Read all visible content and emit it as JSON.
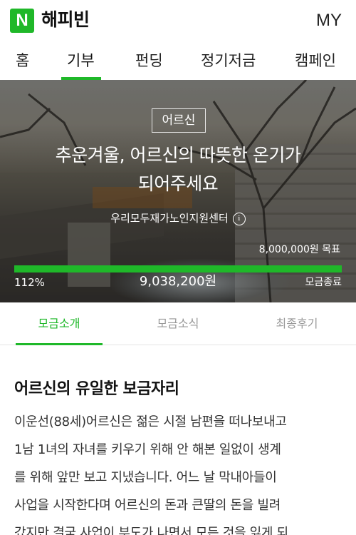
{
  "header": {
    "logo_letter": "N",
    "brand": "해피빈",
    "my_label": "MY"
  },
  "gnb": {
    "items": [
      "홈",
      "기부",
      "펀딩",
      "정기저금",
      "캠페인"
    ],
    "active_index": 1
  },
  "campaign": {
    "category": "어르신",
    "title_line1": "추운겨울, 어르신의 따뜻한 온기가",
    "title_line2": "되어주세요",
    "organization": "우리모두재가노인지원센터",
    "info_icon": "info-icon",
    "goal_text": "8,000,000원 목표",
    "progress_fraction": 1.0,
    "percent_text": "112%",
    "raised_text": "9,038,200원",
    "status_text": "모금종료"
  },
  "tabs": {
    "items": [
      "모금소개",
      "모금소식",
      "최종후기"
    ],
    "active_index": 0
  },
  "story": {
    "heading": "어르신의 유일한 보금자리",
    "lines": [
      "이운선(88세)어르신은 젊은 시절 남편을 떠나보내고",
      "1남 1녀의 자녀를 키우기 위해 안 해본 일없이 생계",
      "를 위해 앞만 보고 지냈습니다. 어느 날 막내아들이",
      "사업을 시작한다며 어르신의 돈과 큰딸의 돈을 빌려",
      "갔지만 결국 사업이 부도가 나면서 모든 것을 잃게 되"
    ]
  },
  "colors": {
    "accent": "#1fb829",
    "text": "#111111",
    "muted": "#999999"
  }
}
